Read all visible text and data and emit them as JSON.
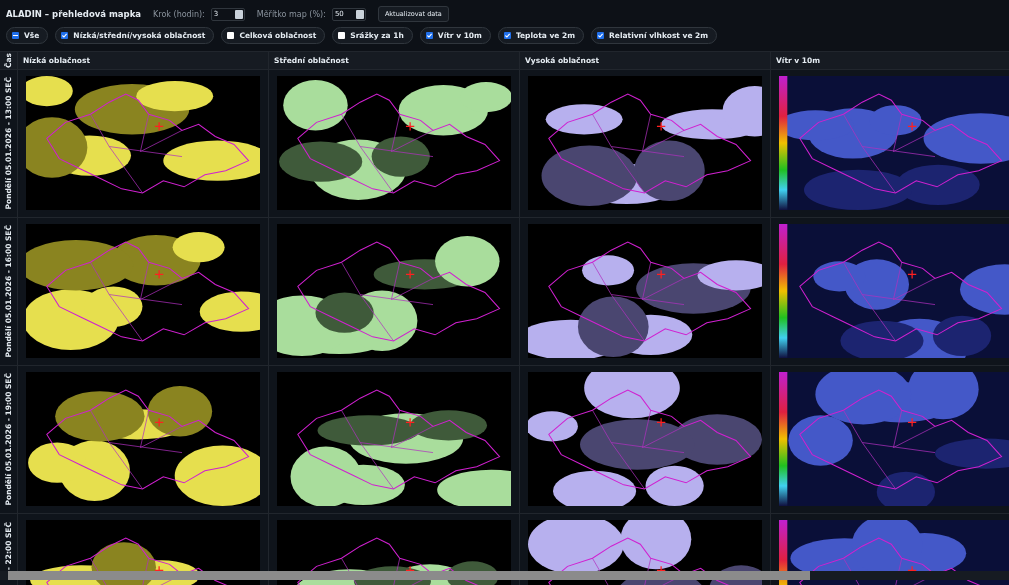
{
  "toolbar": {
    "title": "ALADIN – přehledová mapka",
    "step": {
      "label": "Krok (hodin):",
      "value": "3"
    },
    "scale": {
      "label": "Měřítko map (%):",
      "value": "50"
    },
    "refresh_button": "Aktualizovat data"
  },
  "select_all": {
    "label": "Vše",
    "indeterminate": true
  },
  "filters": [
    {
      "label": "Nízká/střední/vysoká oblačnost",
      "checked": true
    },
    {
      "label": "Celková oblačnost",
      "checked": false
    },
    {
      "label": "Srážky za 1h",
      "checked": false
    },
    {
      "label": "Vítr v 10m",
      "checked": true
    },
    {
      "label": "Teplota ve 2m",
      "checked": true
    },
    {
      "label": "Relativní vlhkost ve 2m",
      "checked": true
    }
  ],
  "table": {
    "time_header": "Čas",
    "columns": [
      "Nízká oblačnost",
      "Střední oblačnost",
      "Vysoká oblačnost",
      "Vítr v 10m"
    ],
    "rows": [
      {
        "time": "Pondělí 05.01.2026 - 13:00 SEČ"
      },
      {
        "time": "Pondělí 05.01.2026 - 16:00 SEČ"
      },
      {
        "time": "Pondělí 05.01.2026 - 19:00 SEČ"
      },
      {
        "time": "- 22:00 SEČ"
      }
    ]
  }
}
